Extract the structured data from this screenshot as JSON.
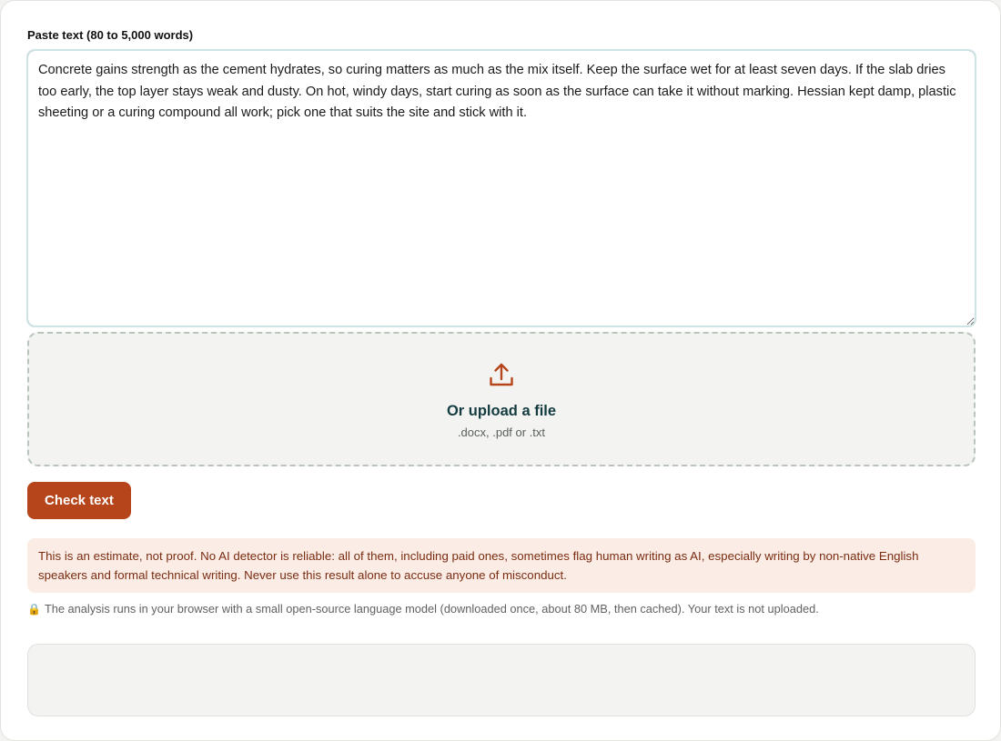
{
  "form": {
    "label": "Paste text (80 to 5,000 words)",
    "text_value": "Concrete gains strength as the cement hydrates, so curing matters as much as the mix itself. Keep the surface wet for at least seven days. If the slab dries too early, the top layer stays weak and dusty. On hot, windy days, start curing as soon as the surface can take it without marking. Hessian kept damp, plastic sheeting or a curing compound all work; pick one that suits the site and stick with it."
  },
  "upload": {
    "icon": "upload-icon",
    "title": "Or upload a file",
    "formats": ".docx, .pdf or .txt"
  },
  "actions": {
    "check_label": "Check text"
  },
  "notices": {
    "warning": "This is an estimate, not proof. No AI detector is reliable: all of them, including paid ones, sometimes flag human writing as AI, especially writing by non-native English speakers and formal technical writing. Never use this result alone to accuse anyone of misconduct.",
    "privacy_icon": "🔒",
    "privacy": "The analysis runs in your browser with a small open-source language model (downloaded once, about 80 MB, then cached). Your text is not uploaded."
  },
  "colors": {
    "accent": "#b7451b",
    "focus_border": "#1e5a5f",
    "warning_bg": "#fbece5",
    "warning_text": "#7a2d12"
  }
}
